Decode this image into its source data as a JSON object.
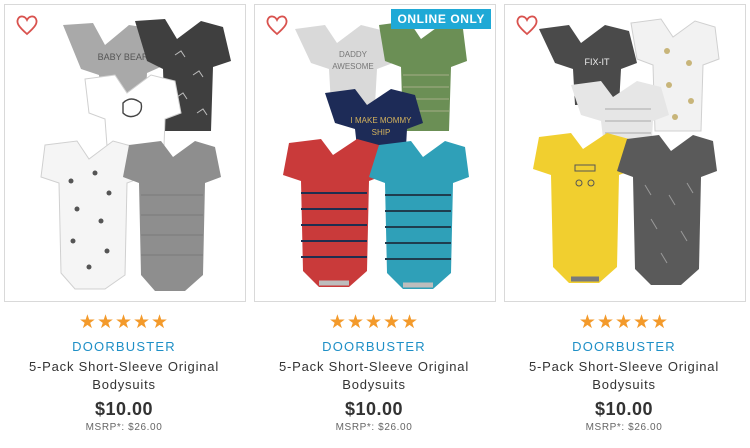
{
  "products": [
    {
      "promo": "DOORBUSTER",
      "title": "5-Pack Short-Sleeve Original Bodysuits",
      "price": "$10.00",
      "msrp": "MSRP*: $26.00",
      "rating": 5,
      "badge": "",
      "stars": "★★★★★",
      "bodysuit_colors": [
        "#a9a9a9",
        "#3f3f3f",
        "#ffffff",
        "#f2f2f2",
        "#8e8e8e"
      ],
      "print_texts": [
        "BABY BEAR"
      ]
    },
    {
      "promo": "DOORBUSTER",
      "title": "5-Pack Short-Sleeve Original Bodysuits",
      "price": "$10.00",
      "msrp": "MSRP*: $26.00",
      "rating": 5,
      "badge": "ONLINE ONLY",
      "stars": "★★★★★",
      "bodysuit_colors": [
        "#d9d9d9",
        "#6b8f55",
        "#1d2b57",
        "#c93a3a",
        "#2fa0b8"
      ],
      "print_texts": [
        "DADDY",
        "AWESOME",
        "I MAKE MOMMY",
        "SHIP"
      ]
    },
    {
      "promo": "DOORBUSTER",
      "title": "5-Pack Short-Sleeve Original Bodysuits",
      "price": "$10.00",
      "msrp": "MSRP*: $26.00",
      "rating": 5,
      "badge": "",
      "stars": "★★★★★",
      "bodysuit_colors": [
        "#4a4a4a",
        "#f2f2f2",
        "#e6e6e6",
        "#f1cf2f",
        "#5a5a5a"
      ],
      "print_texts": [
        "FIX-IT"
      ]
    }
  ],
  "colors": {
    "accent": "#1e8fc6",
    "badge": "#1fa9d6",
    "star": "#f39a2b",
    "heart": "#d9534f"
  },
  "icons": {
    "wishlist": "heart-outline-icon",
    "rating": "star-icon"
  }
}
